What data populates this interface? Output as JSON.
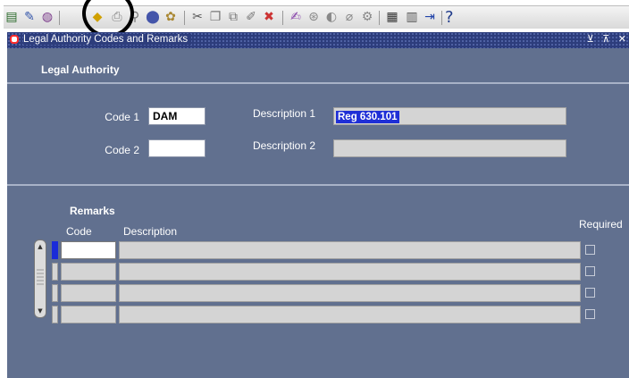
{
  "toolbar": {
    "icons": [
      "new-record-icon",
      "clear-record-icon",
      "delete-icon",
      "save-icon",
      "print-icon",
      "find-icon",
      "navigate-icon",
      "zoom-icon",
      "cut-icon",
      "copy-icon",
      "paste-icon",
      "edit-field-icon",
      "delete-record-icon",
      "translations-icon",
      "attachments-icon",
      "folder-icon",
      "summary-icon",
      "export-icon",
      "calendar-icon",
      "window-icon",
      "exit-icon"
    ],
    "help_glyph": "?"
  },
  "window": {
    "title": "Legal Authority Codes and Remarks",
    "controls": "⊻ ⊼ ✕"
  },
  "legal_authority": {
    "heading": "Legal Authority",
    "code1_label": "Code 1",
    "code1_value": "DAM",
    "code2_label": "Code 2",
    "code2_value": "",
    "description1_label": "Description 1",
    "description1_value": "Reg 630.101",
    "description2_label": "Description 2",
    "description2_value": ""
  },
  "remarks": {
    "heading": "Remarks",
    "col_code": "Code",
    "col_description": "Description",
    "col_required": "Required",
    "rows": [
      {
        "code": "",
        "description": "",
        "required": false
      },
      {
        "code": "",
        "description": "",
        "required": false
      },
      {
        "code": "",
        "description": "",
        "required": false
      },
      {
        "code": "",
        "description": "",
        "required": false
      }
    ]
  },
  "colors": {
    "canvas": "#61708f",
    "titlebar": "#2d3d7c",
    "selection": "#1f2fd6"
  }
}
